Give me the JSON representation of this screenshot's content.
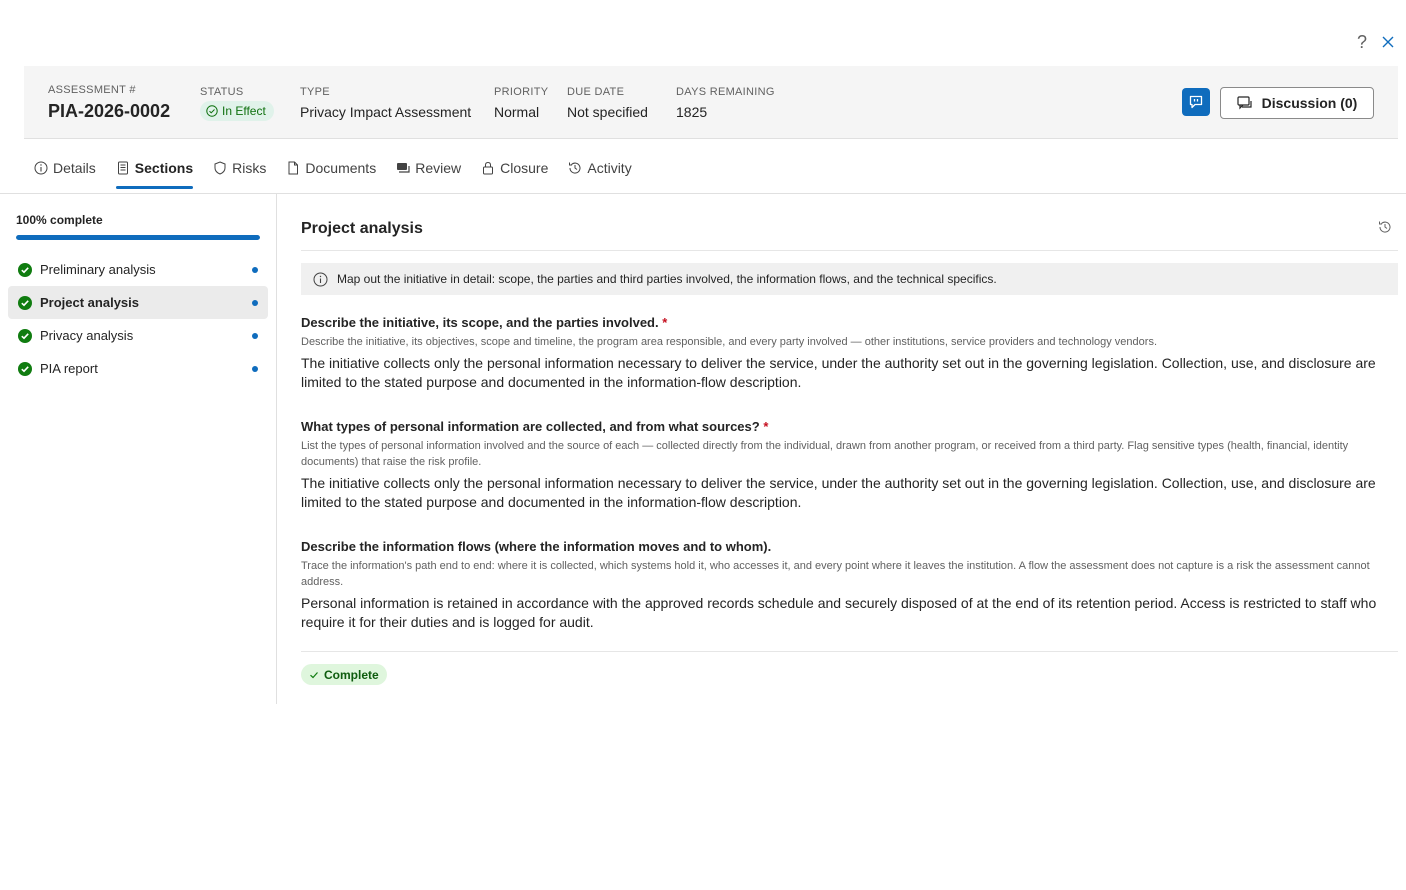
{
  "window": {
    "help_label": "?",
    "close_icon": "close-icon"
  },
  "header": {
    "assessment_label": "ASSESSMENT #",
    "assessment_value": "PIA-2026-0002",
    "status_label": "STATUS",
    "status_value": "In Effect",
    "type_label": "TYPE",
    "type_value": "Privacy Impact Assessment",
    "priority_label": "PRIORITY",
    "priority_value": "Normal",
    "due_label": "DUE DATE",
    "due_value": "Not specified",
    "days_label": "DAYS REMAINING",
    "days_value": "1825",
    "discussion_label": "Discussion (0)"
  },
  "tabs": [
    {
      "label": "Details",
      "icon": "info-icon"
    },
    {
      "label": "Sections",
      "icon": "sections-icon",
      "active": true
    },
    {
      "label": "Risks",
      "icon": "shield-icon"
    },
    {
      "label": "Documents",
      "icon": "document-icon"
    },
    {
      "label": "Review",
      "icon": "review-icon"
    },
    {
      "label": "Closure",
      "icon": "lock-icon"
    },
    {
      "label": "Activity",
      "icon": "history-icon"
    }
  ],
  "sidebar": {
    "progress_label": "100% complete",
    "progress_fraction": 1.0,
    "items": [
      {
        "label": "Preliminary analysis",
        "complete": true
      },
      {
        "label": "Project analysis",
        "complete": true,
        "active": true
      },
      {
        "label": "Privacy analysis",
        "complete": true
      },
      {
        "label": "PIA report",
        "complete": true
      }
    ]
  },
  "content": {
    "title": "Project analysis",
    "info": "Map out the initiative in detail: scope, the parties and third parties involved, the information flows, and the technical specifics.",
    "questions": [
      {
        "title": "Describe the initiative, its scope, and the parties involved.",
        "required_mark": "*",
        "hint": "Describe the initiative, its objectives, scope and timeline, the program area responsible, and every party involved — other institutions, service providers and technology vendors.",
        "answer": "The initiative collects only the personal information necessary to deliver the service, under the authority set out in the governing legislation. Collection, use, and disclosure are limited to the stated purpose and documented in the information-flow description."
      },
      {
        "title": "What types of personal information are collected, and from what sources?",
        "required_mark": "*",
        "hint": "List the types of personal information involved and the source of each — collected directly from the individual, drawn from another program, or received from a third party. Flag sensitive types (health, financial, identity documents) that raise the risk profile.",
        "answer": "The initiative collects only the personal information necessary to deliver the service, under the authority set out in the governing legislation. Collection, use, and disclosure are limited to the stated purpose and documented in the information-flow description."
      },
      {
        "title": "Describe the information flows (where the information moves and to whom).",
        "required_mark": "",
        "hint": "Trace the information's path end to end: where it is collected, which systems hold it, who accesses it, and every point where it leaves the institution. A flow the assessment does not capture is a risk the assessment cannot address.",
        "answer": "Personal information is retained in accordance with the approved records schedule and securely disposed of at the end of its retention period. Access is restricted to staff who require it for their duties and is logged for audit."
      }
    ],
    "complete_label": "Complete"
  },
  "colors": {
    "accent": "#0f6cbd",
    "success": "#0e700e",
    "required": "#c50f1f"
  }
}
